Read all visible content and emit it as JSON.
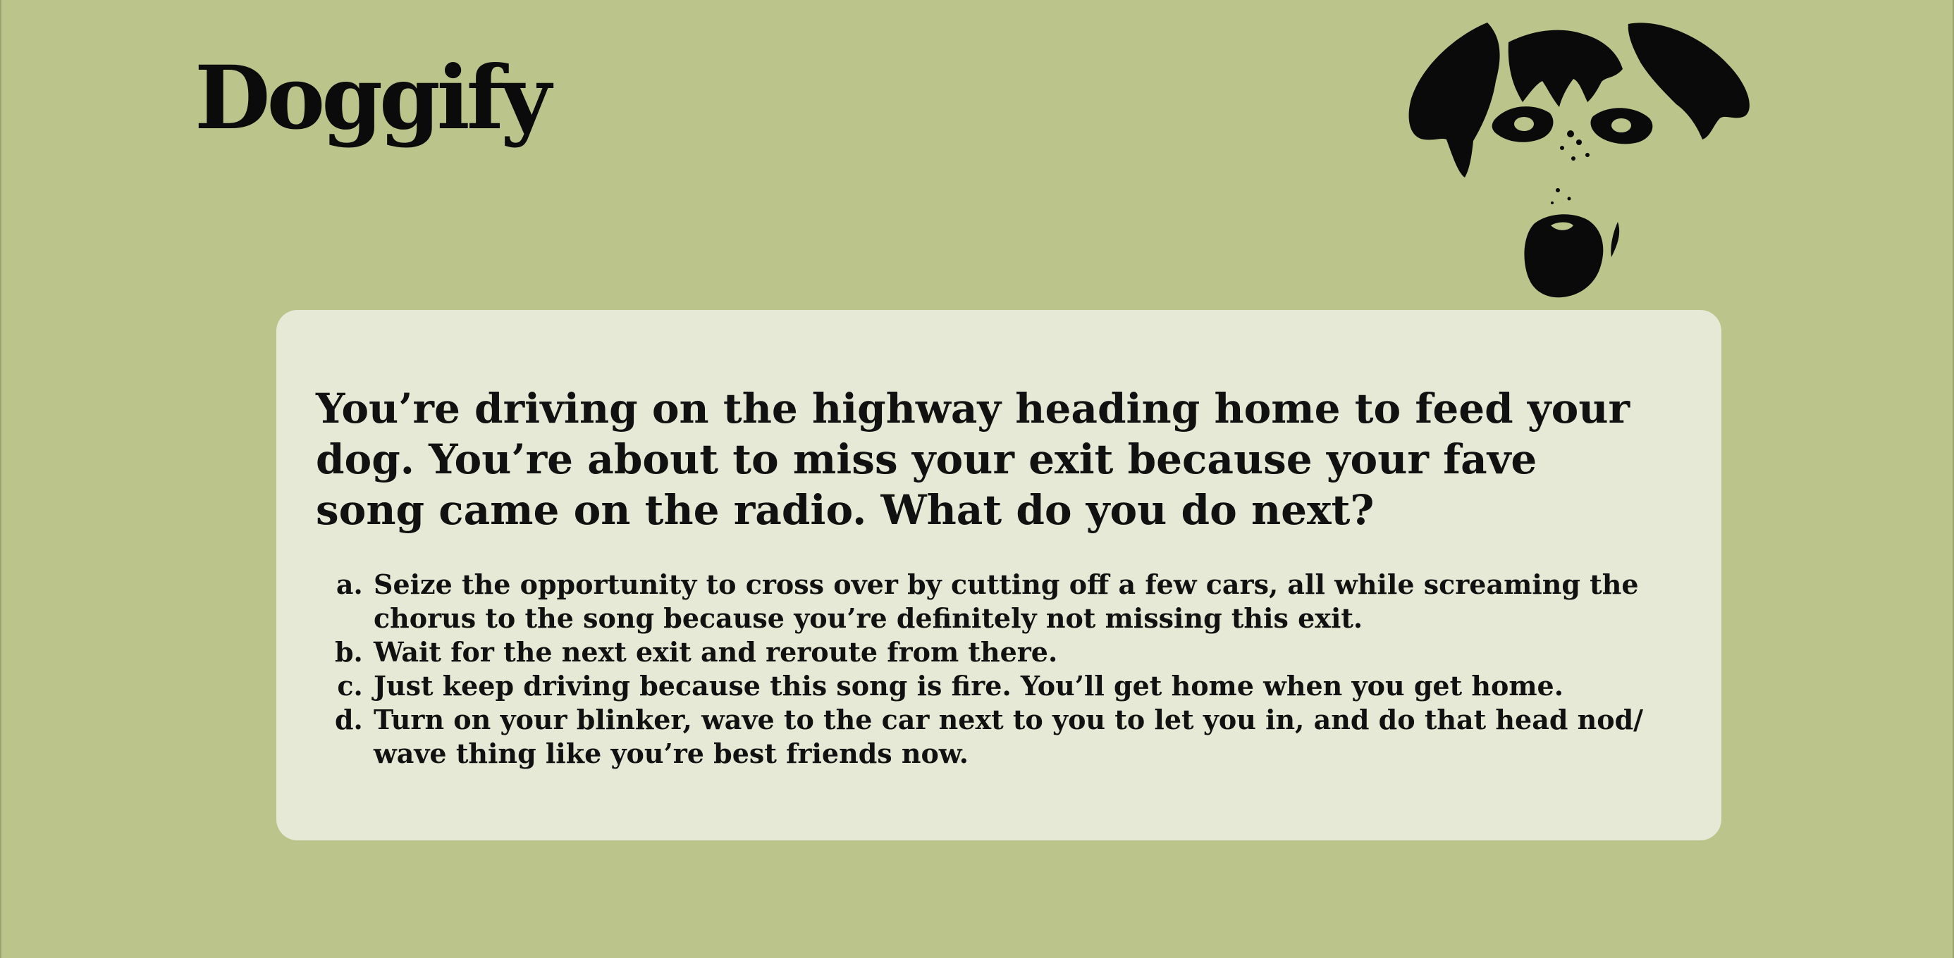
{
  "brand": {
    "name": "Doggify",
    "logo_icon": "dog-face-icon"
  },
  "colors": {
    "page_background": "#bbc48b",
    "card_background": "#e6e9d6",
    "text": "#111111"
  },
  "quiz": {
    "question": "You’re driving on the highway heading home to feed your dog. You’re about to miss your exit because your fave song came on the radio. What do you do next?",
    "answers": [
      {
        "marker": "a",
        "text": "Seize the opportunity to cross over by cutting off a few cars, all while screaming the chorus to the song because you’re definitely not missing this exit."
      },
      {
        "marker": "b",
        "text": "Wait for the next exit and reroute from there."
      },
      {
        "marker": "c",
        "text": "Just keep driving because this song is fire. You’ll get home when you get home."
      },
      {
        "marker": "d",
        "text": "Turn on your blinker, wave to the car next to you to let you in, and do that head nod/ wave thing like you’re best friends now."
      }
    ]
  }
}
